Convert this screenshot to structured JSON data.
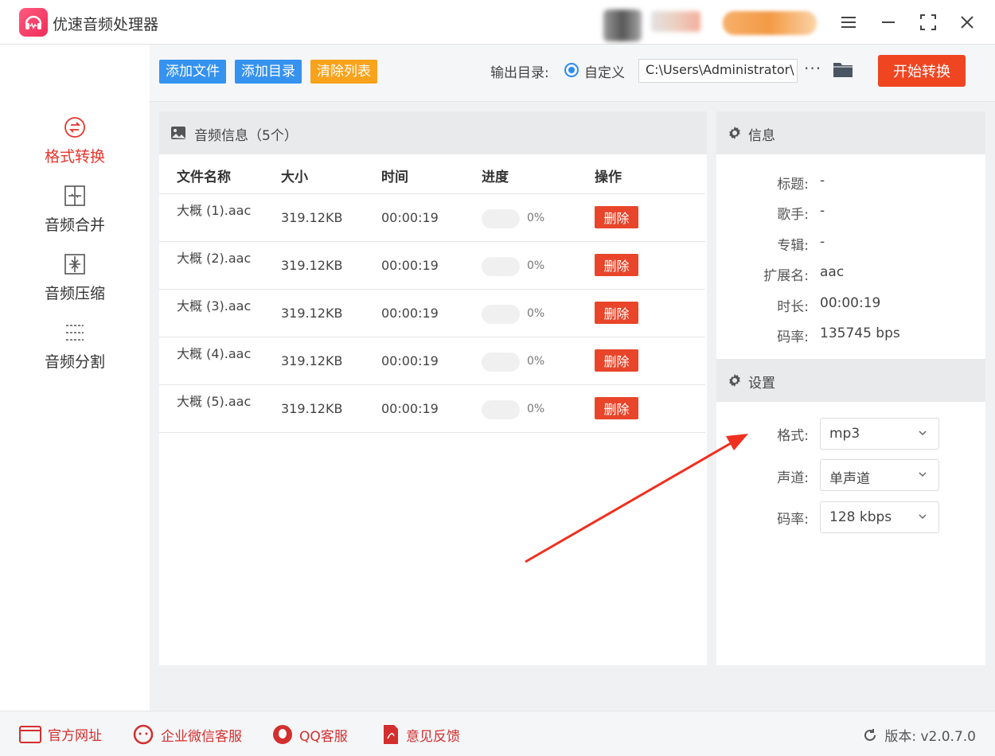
{
  "app": {
    "title": "优速音频处理器"
  },
  "sidebar": {
    "items": [
      {
        "label": "格式转换",
        "icon": "format-convert-icon",
        "active": true
      },
      {
        "label": "音频合并",
        "icon": "merge-icon",
        "active": false
      },
      {
        "label": "音频压缩",
        "icon": "compress-icon",
        "active": false
      },
      {
        "label": "音频分割",
        "icon": "split-icon",
        "active": false
      }
    ]
  },
  "toolbar": {
    "add_file": "添加文件",
    "add_dir": "添加目录",
    "clear_list": "清除列表",
    "output_label": "输出目录:",
    "radio_label": "自定义",
    "output_path": "C:\\Users\\Administrator\\",
    "more": "···",
    "start": "开始转换"
  },
  "list": {
    "title": "音频信息（5个）",
    "headers": {
      "name": "文件名称",
      "size": "大小",
      "time": "时间",
      "progress": "进度",
      "action": "操作"
    },
    "rows": [
      {
        "name": "大概 (1).aac",
        "size": "319.12KB",
        "time": "00:00:19",
        "progress": 0,
        "progress_text": "0%",
        "action": "删除"
      },
      {
        "name": "大概 (2).aac",
        "size": "319.12KB",
        "time": "00:00:19",
        "progress": 0,
        "progress_text": "0%",
        "action": "删除"
      },
      {
        "name": "大概 (3).aac",
        "size": "319.12KB",
        "time": "00:00:19",
        "progress": 0,
        "progress_text": "0%",
        "action": "删除"
      },
      {
        "name": "大概 (4).aac",
        "size": "319.12KB",
        "time": "00:00:19",
        "progress": 0,
        "progress_text": "0%",
        "action": "删除"
      },
      {
        "name": "大概 (5).aac",
        "size": "319.12KB",
        "time": "00:00:19",
        "progress": 0,
        "progress_text": "0%",
        "action": "删除"
      }
    ]
  },
  "info": {
    "title": "信息",
    "fields": [
      {
        "label": "标题:",
        "value": "-"
      },
      {
        "label": "歌手:",
        "value": "-"
      },
      {
        "label": "专辑:",
        "value": "-"
      },
      {
        "label": "扩展名:",
        "value": "aac"
      },
      {
        "label": "时长:",
        "value": "00:00:19"
      },
      {
        "label": "码率:",
        "value": "135745 bps"
      }
    ]
  },
  "settings": {
    "title": "设置",
    "format_label": "格式:",
    "format_value": "mp3",
    "channel_label": "声道:",
    "channel_value": "单声道",
    "bitrate_label": "码率:",
    "bitrate_value": "128 kbps"
  },
  "footer": {
    "website": "官方网址",
    "wechat": "企业微信客服",
    "qq": "QQ客服",
    "feedback": "意见反馈",
    "version": "版本: v2.0.7.0"
  },
  "colors": {
    "accent_red": "#e8352c",
    "blue": "#3592ef",
    "orange": "#f9a21b",
    "start": "#f04521"
  }
}
